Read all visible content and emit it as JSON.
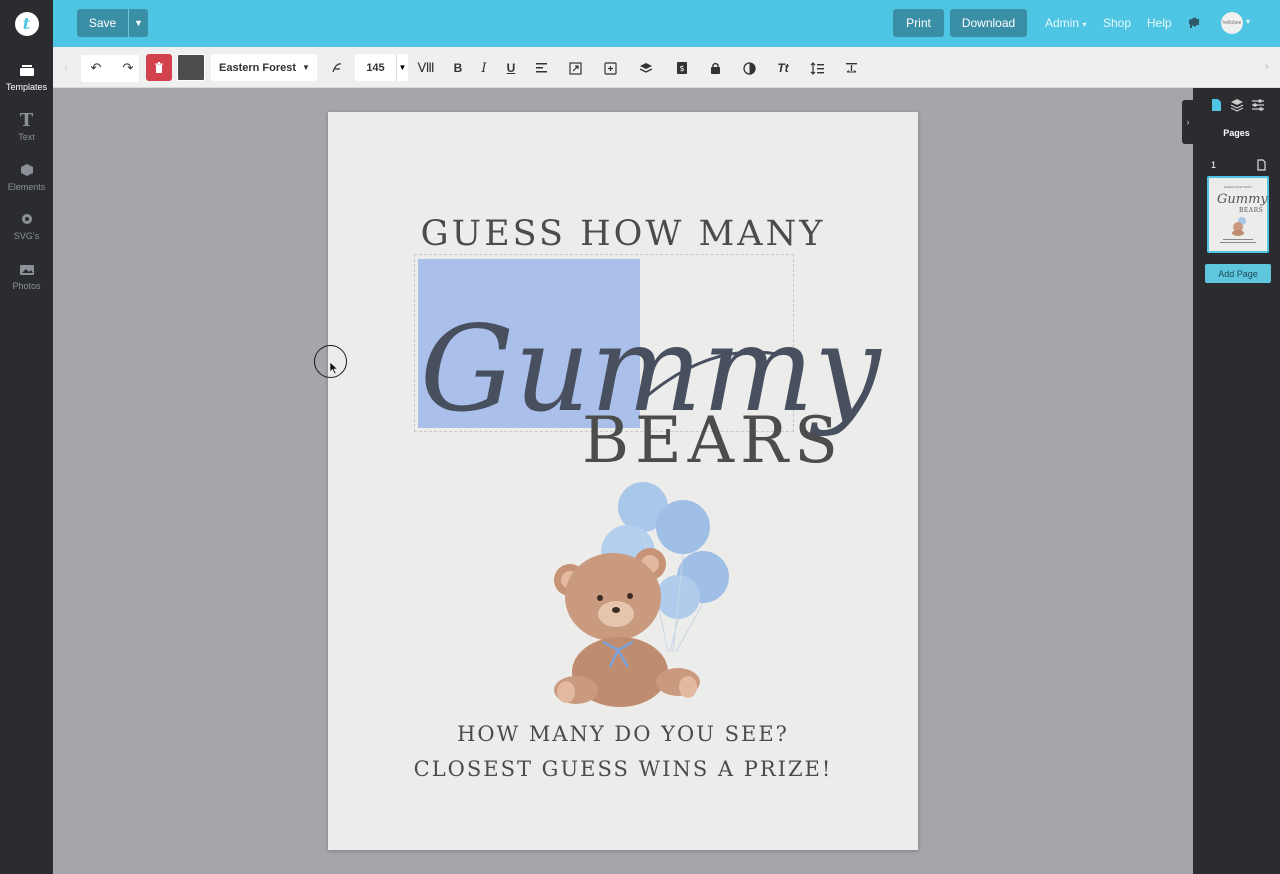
{
  "topbar": {
    "save_label": "Save",
    "print_label": "Print",
    "download_label": "Download",
    "admin_label": "Admin",
    "shop_label": "Shop",
    "help_label": "Help",
    "avatar_text": "hellobee"
  },
  "sidebar": {
    "items": [
      {
        "label": "Templates",
        "icon": "templates-icon"
      },
      {
        "label": "Text",
        "icon": "text-icon"
      },
      {
        "label": "Elements",
        "icon": "elements-icon"
      },
      {
        "label": "SVG's",
        "icon": "svg-icon"
      },
      {
        "label": "Photos",
        "icon": "photos-icon"
      }
    ]
  },
  "toolbar": {
    "font_name": "Eastern Forest",
    "font_size": "145",
    "text_color": "#4c4c4c",
    "delete_color": "#d2424c"
  },
  "canvas": {
    "heading": "GUESS HOW MANY",
    "script_word": "Gummy",
    "bears_word": "BEARS",
    "line1": "HOW MANY DO YOU SEE?",
    "line2": "CLOSEST GUESS WINS A PRIZE!"
  },
  "right_panel": {
    "title": "Pages",
    "page_number": "1",
    "thumb_heading": "GUESS HOW MANY",
    "thumb_script": "Gummy",
    "thumb_bears": "BEARS",
    "add_page_label": "Add Page"
  },
  "colors": {
    "accent": "#4ec6e3",
    "button": "#3a8ea6",
    "dark": "#2a2c30",
    "selection": "#aabfea"
  }
}
